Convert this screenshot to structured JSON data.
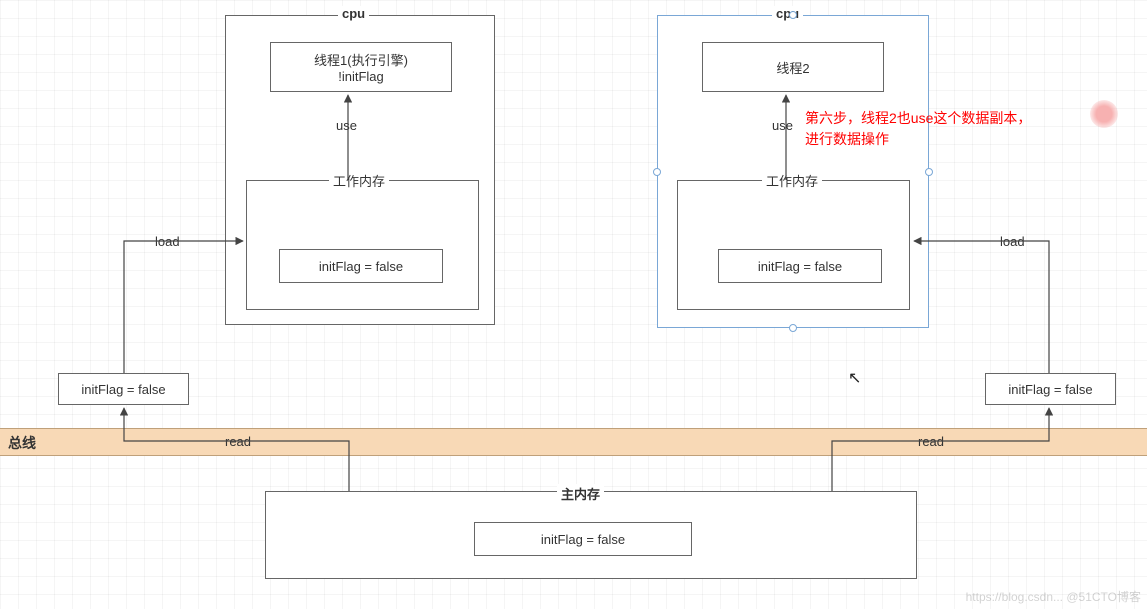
{
  "cpu1": {
    "title": "cpu",
    "thread_box": "线程1(执行引擎)\n!initFlag",
    "use_label": "use",
    "workmem_title": "工作内存",
    "workmem_value": "initFlag = false",
    "load_label": "load",
    "local_copy": "initFlag = false",
    "read_label": "read"
  },
  "cpu2": {
    "title": "cpu",
    "thread_box": "线程2",
    "use_label": "use",
    "workmem_title": "工作内存",
    "workmem_value": "initFlag = false",
    "load_label": "load",
    "local_copy": "initFlag = false",
    "read_label": "read"
  },
  "bus_label": "总线",
  "main_memory": {
    "title": "主内存",
    "value": "initFlag = false"
  },
  "annotation_line1": "第六步，线程2也use这个数据副本，",
  "annotation_line2": "进行数据操作",
  "watermark": "https://blog.csdn... @51CTO博客"
}
